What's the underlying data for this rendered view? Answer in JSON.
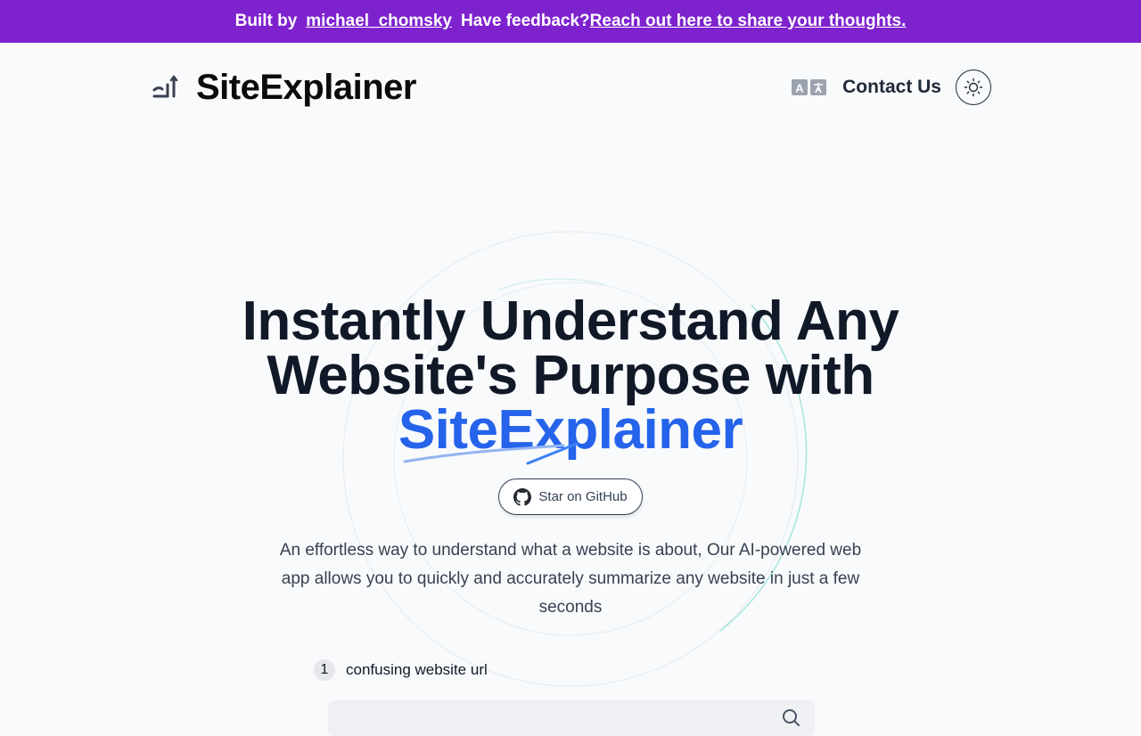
{
  "banner": {
    "built_by": "Built by",
    "author": "michael_chomsky",
    "feedback": "Have feedback?",
    "reach_out": " Reach out here to share your thoughts."
  },
  "header": {
    "logo_text": "SiteExplainer",
    "contact": "Contact Us",
    "icons": [
      "logo-icon",
      "translate-icon",
      "sun-icon"
    ]
  },
  "hero": {
    "line1": "Instantly Understand Any",
    "line2": "Website's Purpose with",
    "brand": "SiteExplainer",
    "github_button": "Star on GitHub",
    "description": "An effortless way to understand what a website is about, Our AI-powered web app allows you to quickly and accurately summarize any website in just a few seconds"
  },
  "step1": {
    "number": "1",
    "label": "confusing website url"
  },
  "url_input": {
    "value": "",
    "placeholder": ""
  },
  "colors": {
    "banner_bg": "#7e22ce",
    "brand_blue": "#2563eb",
    "page_bg": "#f8fafc"
  }
}
